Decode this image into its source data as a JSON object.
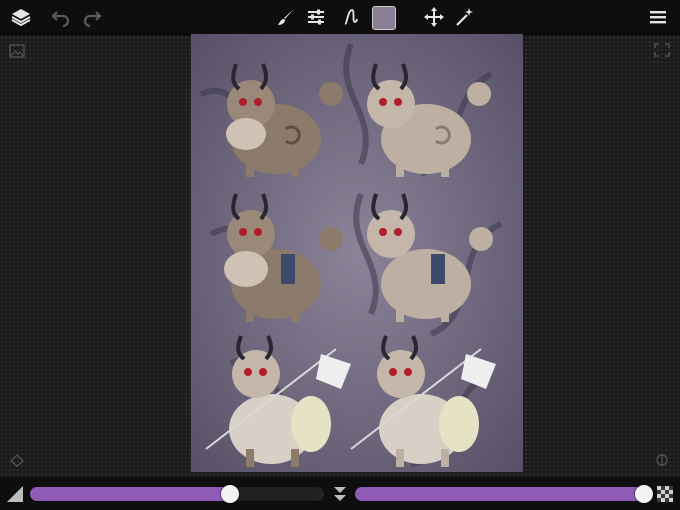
{
  "toolbar": {
    "layers_icon": "layers-icon",
    "undo_icon": "undo-icon",
    "redo_icon": "redo-icon",
    "brush_icon": "brush-icon",
    "adjust_icon": "sliders-icon",
    "stroke_icon": "stroke-icon",
    "color": "#8a7f95",
    "move_icon": "move-icon",
    "magic_icon": "magic-wand-icon",
    "menu_icon": "menu-icon"
  },
  "canvas": {
    "background_color": "#6e6780",
    "figures_count_rows": 3
  },
  "brush": {
    "size_level": 0.68,
    "opacity_level": 0.98
  },
  "colors": {
    "accent": "#8f5bb6",
    "toolbar_bg": "#0e0e0e"
  }
}
